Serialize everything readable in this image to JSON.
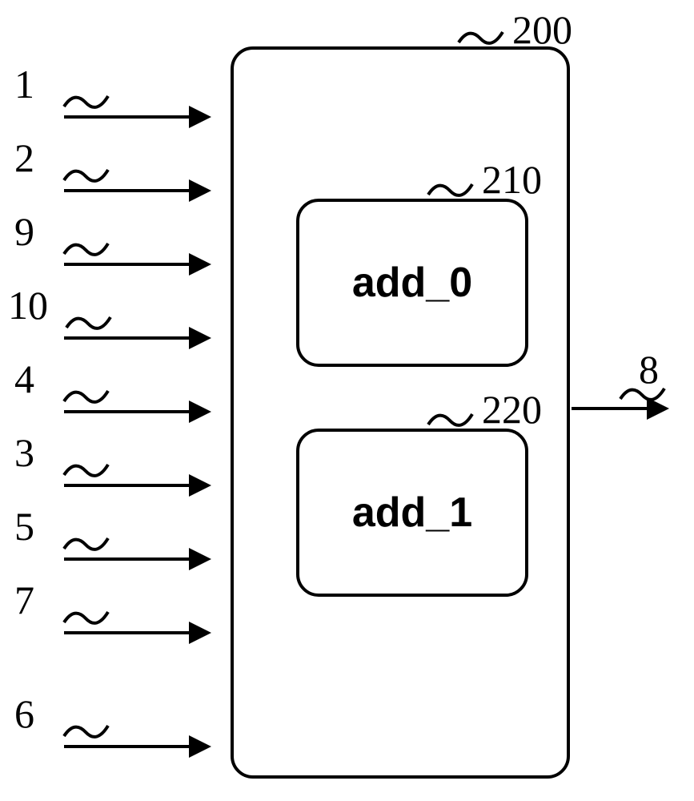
{
  "labels": {
    "main": "200",
    "block0": "210",
    "block1": "220",
    "block0_text": "add_0",
    "block1_text": "add_1",
    "in1": "1",
    "in2": "2",
    "in3": "9",
    "in4": "10",
    "in5": "4",
    "in6": "3",
    "in7": "5",
    "in8": "7",
    "in9": "6",
    "out": "8"
  }
}
